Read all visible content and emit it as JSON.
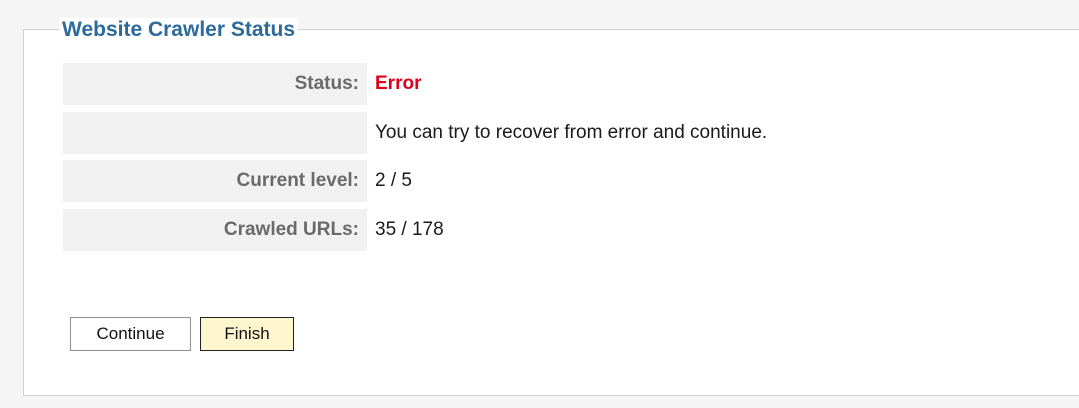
{
  "panel": {
    "title": "Website Crawler Status"
  },
  "rows": [
    {
      "label": "Status:",
      "value": "Error"
    },
    {
      "label": "",
      "value": "You can try to recover from error and continue."
    },
    {
      "label": "Current level:",
      "value": "2 / 5"
    },
    {
      "label": "Crawled URLs:",
      "value": "35 / 178"
    }
  ],
  "buttons": {
    "continue_label": "Continue",
    "finish_label": "Finish"
  },
  "colors": {
    "title": "#2b6a9b",
    "error": "#e0001b",
    "label_bg": "#f1f1f1",
    "finish_bg": "#fdf6cf"
  }
}
